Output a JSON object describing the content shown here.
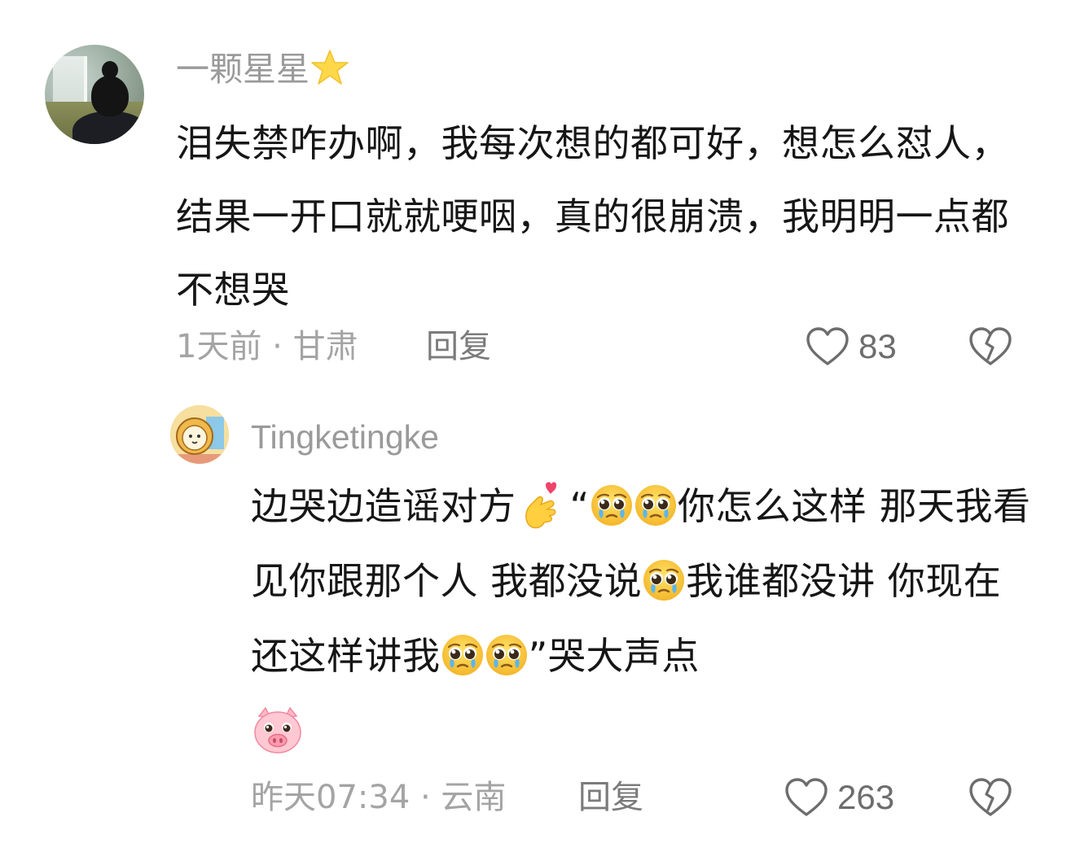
{
  "comments": [
    {
      "username": "一颗星星",
      "username_badge_icon": "star-emoji",
      "text": "泪失禁咋办啊，我每次想的都可好，想怎么怼人，结果一开口就就哽咽，真的很崩溃，我明明一点都不想哭",
      "meta": "1天前 · 甘肃",
      "reply_label": "回复",
      "like_count": "83"
    },
    {
      "username": "Tingketingke",
      "text_parts": {
        "p1": "边哭边造谣对方",
        "p2": "“",
        "p3": "你怎么这样 那天我看见你跟那个人 我都没说",
        "p4": "我谁都没讲 你现在还这样讲我",
        "p5": "”哭大声点"
      },
      "emojis": [
        "finger-heart-emoji",
        "pleading-teary-face-emoji",
        "pig-face-emoji"
      ],
      "meta": "昨天07:34 · 云南",
      "reply_label": "回复",
      "like_count": "263"
    }
  ],
  "colors": {
    "text": "#161616",
    "username": "#9a9a9a",
    "meta": "#a4a4a4",
    "reply": "#7b7b7b",
    "icon": "#6d6d6d",
    "background": "#ffffff"
  }
}
